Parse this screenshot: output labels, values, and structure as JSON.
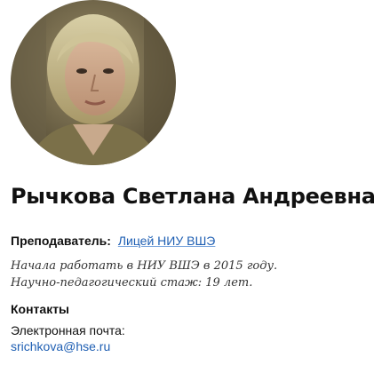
{
  "profile": {
    "photo_icon": "person-portrait-photo",
    "name": "Рычкова Светлана Андреевна",
    "role_label": "Преподаватель:",
    "role_link": "Лицей НИУ ВШЭ",
    "bio_line1": "Начала работать в НИУ ВШЭ в 2015 году.",
    "bio_line2": "Научно-педагогический стаж: 19 лет."
  },
  "contacts": {
    "heading": "Контакты",
    "email_label": "Электронная почта:",
    "email": "srichkova@hse.ru"
  },
  "colors": {
    "link": "#1f5fb3",
    "text": "#111111"
  }
}
